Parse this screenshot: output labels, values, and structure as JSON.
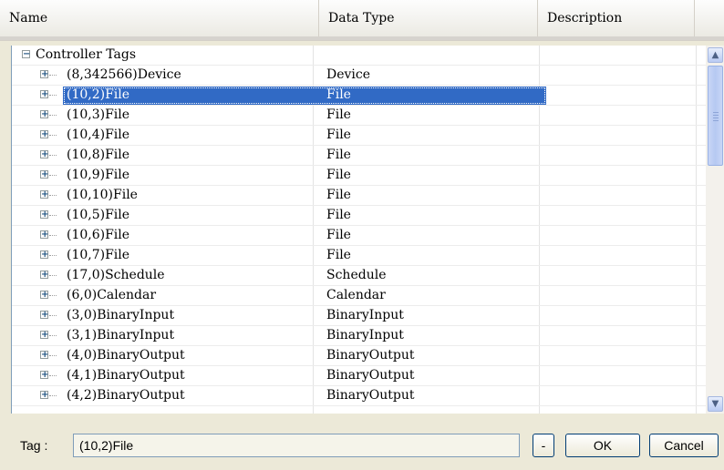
{
  "columns": {
    "name": "Name",
    "data_type": "Data Type",
    "description": "Description"
  },
  "tree": {
    "root_label": "Controller Tags",
    "rows": [
      {
        "name": "(8,342566)Device",
        "type": "Device"
      },
      {
        "name": "(10,2)File",
        "type": "File",
        "selected": true
      },
      {
        "name": "(10,3)File",
        "type": "File"
      },
      {
        "name": "(10,4)File",
        "type": "File"
      },
      {
        "name": "(10,8)File",
        "type": "File"
      },
      {
        "name": "(10,9)File",
        "type": "File"
      },
      {
        "name": "(10,10)File",
        "type": "File"
      },
      {
        "name": "(10,5)File",
        "type": "File"
      },
      {
        "name": "(10,6)File",
        "type": "File"
      },
      {
        "name": "(10,7)File",
        "type": "File"
      },
      {
        "name": "(17,0)Schedule",
        "type": "Schedule"
      },
      {
        "name": "(6,0)Calendar",
        "type": "Calendar"
      },
      {
        "name": "(3,0)BinaryInput",
        "type": "BinaryInput"
      },
      {
        "name": "(3,1)BinaryInput",
        "type": "BinaryInput"
      },
      {
        "name": "(4,0)BinaryOutput",
        "type": "BinaryOutput"
      },
      {
        "name": "(4,1)BinaryOutput",
        "type": "BinaryOutput"
      },
      {
        "name": "(4,2)BinaryOutput",
        "type": "BinaryOutput"
      }
    ]
  },
  "icons": {
    "expand": "plus-box-icon",
    "collapse": "minus-box-icon",
    "scroll_up": "arrow-up-icon",
    "scroll_down": "arrow-down-icon"
  },
  "colors": {
    "selection": "#316ac5",
    "window_bg": "#ece9d8"
  },
  "footer": {
    "tag_label": "Tag :",
    "tag_value": "(10,2)File",
    "minus_label": "-",
    "ok_label": "OK",
    "cancel_label": "Cancel"
  }
}
